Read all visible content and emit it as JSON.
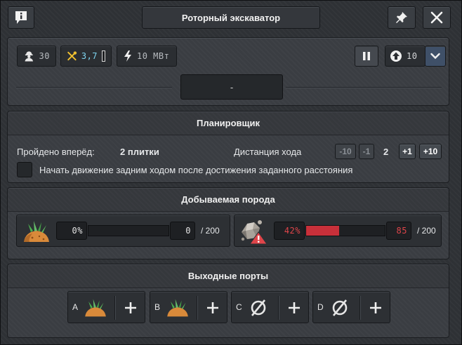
{
  "window": {
    "title": "Роторный экскаватор",
    "icons": {
      "info": "info-icon",
      "pin": "pin-icon",
      "close": "close-icon"
    }
  },
  "status": {
    "workers": "30",
    "maintenance": "3,7",
    "power": "10 МВт",
    "upgrade_level": "10",
    "current_state": "-"
  },
  "planner": {
    "title": "Планировщик",
    "traveled_label": "Пройдено вперёд:",
    "traveled_value": "2 плитки",
    "distance_label": "Дистанция хода",
    "distance_value": "2",
    "buttons": [
      "-10",
      "-1",
      "+1",
      "+10"
    ],
    "reverse_checkbox_label": "Начать движение задним ходом после достижения заданного расстояния",
    "reverse_checked": false
  },
  "mined": {
    "title": "Добываемая порода",
    "items": [
      {
        "icon": "dirt-icon",
        "percent": "0%",
        "amount": "0",
        "capacity": "/ 200",
        "fill": 0
      },
      {
        "icon": "rock-warning-icon",
        "percent": "42%",
        "amount": "85",
        "capacity": "/ 200",
        "fill": 0.42
      }
    ]
  },
  "ports": {
    "title": "Выходные порты",
    "items": [
      {
        "letter": "A",
        "icon": "dirt-icon"
      },
      {
        "letter": "B",
        "icon": "dirt-icon"
      },
      {
        "letter": "C",
        "icon": "empty-slot-icon"
      },
      {
        "letter": "D",
        "icon": "empty-slot-icon"
      }
    ]
  },
  "colors": {
    "accent_cyan": "#7fd6f2",
    "warning_red": "#e0454a",
    "bar_red": "#c8303a",
    "text": "#e6e8ea"
  }
}
